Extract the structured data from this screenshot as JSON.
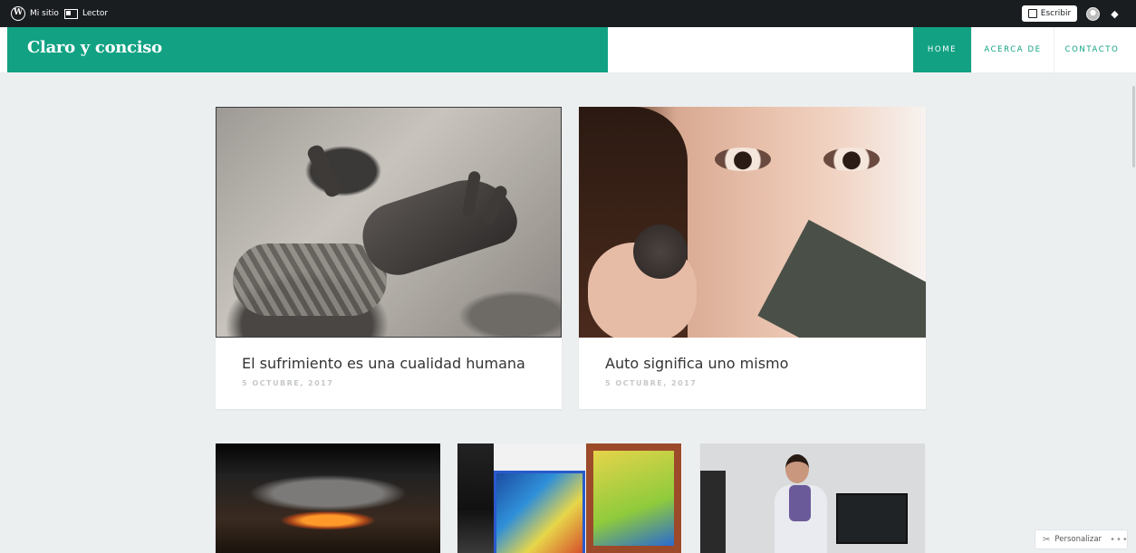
{
  "adminbar": {
    "my_site": "Mi sitio",
    "reader": "Lector",
    "write": "Escribir"
  },
  "site": {
    "title": "Claro y conciso",
    "accent": "#12a283"
  },
  "nav": {
    "home": "HOME",
    "about": "ACERCA DE",
    "contact": "CONTACTO"
  },
  "posts": [
    {
      "title": "El sufrimiento es una cualidad humana",
      "date": "5 OCTUBRE, 2017"
    },
    {
      "title": "Auto significa uno mismo",
      "date": "5 OCTUBRE, 2017"
    }
  ],
  "customize": {
    "label": "Personalizar",
    "more": "•••"
  }
}
